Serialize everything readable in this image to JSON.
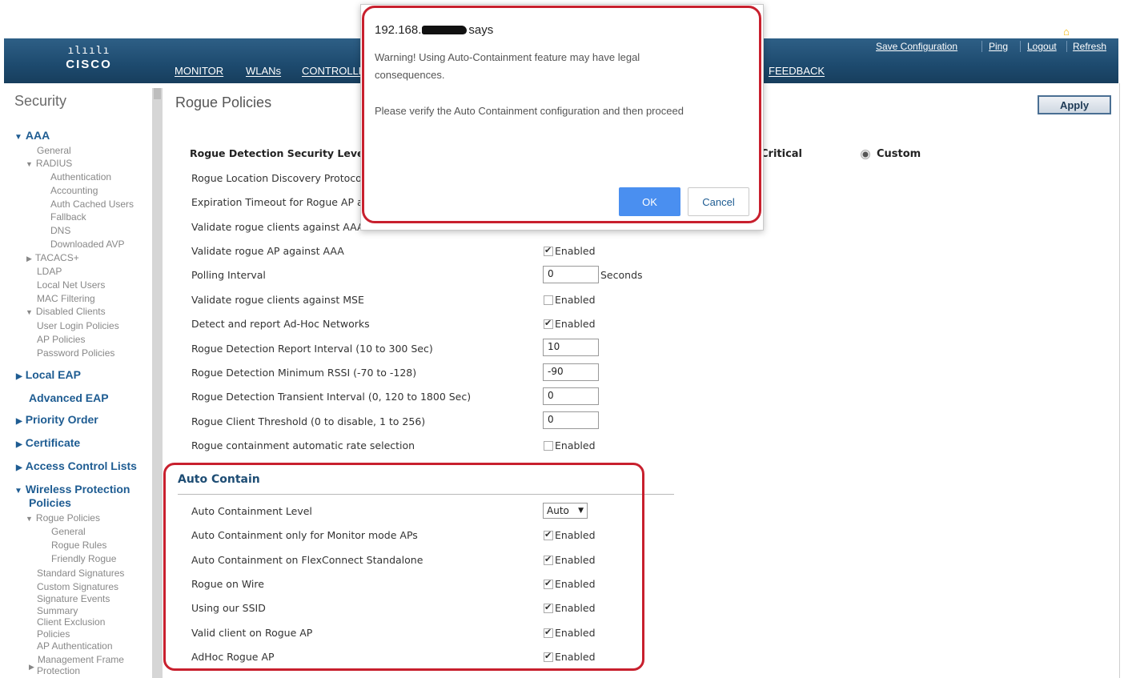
{
  "brand": {
    "logo_bars": "ılıılı",
    "logo_word": "CISCO"
  },
  "topbar": {
    "nav": [
      "MONITOR",
      "WLANs",
      "CONTROLLER",
      "FEEDBACK"
    ],
    "links": {
      "save_configuration": "Save Configuration",
      "ping": "Ping",
      "logout": "Logout",
      "refresh": "Refresh"
    },
    "home": "Home"
  },
  "sidebar": {
    "title": "Security",
    "aaa": "AAA",
    "general": "General",
    "radius": "RADIUS",
    "authentication": "Authentication",
    "accounting": "Accounting",
    "auth_cached_users": "Auth Cached Users",
    "fallback": "Fallback",
    "dns": "DNS",
    "downloaded_avp": "Downloaded AVP",
    "tacacs": "TACACS+",
    "ldap": "LDAP",
    "local_net_users": "Local Net Users",
    "mac_filtering": "MAC Filtering",
    "disabled_clients": "Disabled Clients",
    "user_login_policies": "User Login Policies",
    "ap_policies": "AP Policies",
    "password_policies": "Password Policies",
    "local_eap": "Local EAP",
    "advanced_eap": "Advanced EAP",
    "priority_order": "Priority Order",
    "certificate": "Certificate",
    "access_control_lists": "Access Control Lists",
    "wireless_protection_policies_1": "Wireless Protection",
    "wireless_protection_policies_2": "Policies",
    "rogue_policies": "Rogue Policies",
    "rogue_general": "General",
    "rogue_rules": "Rogue Rules",
    "friendly_rogue": "Friendly Rogue",
    "standard_signatures": "Standard Signatures",
    "custom_signatures": "Custom Signatures",
    "signature_events_1": "Signature Events",
    "signature_events_2": "Summary",
    "client_exclusion_1": "Client Exclusion",
    "client_exclusion_2": "Policies",
    "ap_authentication": "AP Authentication",
    "management_frame_1": "Management Frame",
    "management_frame_2": "Protection"
  },
  "main": {
    "title": "Rogue Policies",
    "apply": "Apply",
    "detection_level_label": "Rogue Detection Security Leve",
    "critical": "Critical",
    "custom": "Custom",
    "rows": {
      "location_discovery": "Rogue Location Discovery Protoco",
      "expiration_timeout": "Expiration Timeout for Rogue AP a",
      "validate_clients_aaa": "Validate rogue clients against AAA",
      "validate_ap_aaa": "Validate rogue AP against AAA",
      "polling_interval": "Polling Interval",
      "validate_clients_mse": "Validate rogue clients against MSE",
      "detect_adhoc": "Detect and report Ad-Hoc Networks",
      "report_interval": "Rogue Detection Report Interval (10 to 300 Sec)",
      "min_rssi": "Rogue Detection Minimum RSSI (-70 to -128)",
      "transient_interval": "Rogue Detection Transient Interval (0, 120 to 1800 Sec)",
      "client_threshold": "Rogue Client Threshold (0 to disable, 1 to 256)",
      "rate_selection": "Rogue containment automatic rate selection"
    },
    "values": {
      "polling_interval": "0",
      "polling_unit": "Seconds",
      "report_interval": "10",
      "min_rssi": "-90",
      "transient_interval": "0",
      "client_threshold": "0"
    },
    "enabled": "Enabled",
    "auto_contain": {
      "header": "Auto Contain",
      "level_label": "Auto Containment Level",
      "level_value": "Auto",
      "monitor_mode": "Auto Containment only for Monitor mode APs",
      "flexconnect": "Auto Containment on FlexConnect Standalone",
      "rogue_on_wire": "Rogue on Wire",
      "using_our_ssid": "Using our SSID",
      "valid_client": "Valid client on Rogue AP",
      "adhoc": "AdHoc Rogue AP"
    }
  },
  "dialog": {
    "title_prefix": "192.168.",
    "title_suffix": "says",
    "line1": "Warning! Using Auto-Containment feature may have legal",
    "line2": "consequences.",
    "line3": "Please verify the Auto Containment configuration and then proceed",
    "ok": "OK",
    "cancel": "Cancel"
  },
  "colors": {
    "nav_bar": "#1d4a6e",
    "link_blue": "#1e5c92",
    "highlight_red": "#c8202e",
    "ok_button": "#4a8ff0"
  }
}
